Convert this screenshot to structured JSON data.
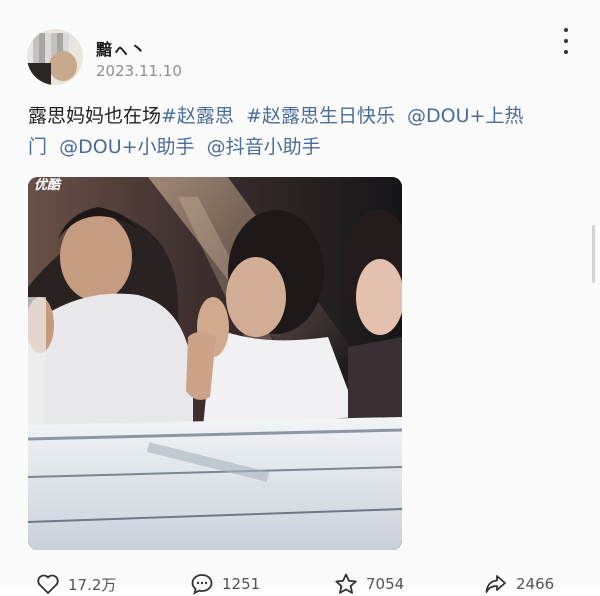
{
  "post": {
    "username": "黯ㇸ丶",
    "date": "2023.11.10",
    "text_line1_prefix": "露思妈妈也在场",
    "tags": [
      "#赵露思",
      "#赵露思生日快乐",
      "@DOU+上热门",
      "@DOU+小助手",
      "@抖音小助手"
    ],
    "media_watermark": "优酷"
  },
  "actions": {
    "like_count": "17.2万",
    "comment_count": "1251",
    "star_count": "7054",
    "share_count": "2466"
  },
  "icons": {
    "more": "more-vertical-icon",
    "like": "heart-icon",
    "comment": "comment-bubble-icon",
    "star": "star-icon",
    "share": "share-icon"
  },
  "colors": {
    "tag": "#4a6d99",
    "text": "#222222",
    "muted": "#8e8e93"
  }
}
